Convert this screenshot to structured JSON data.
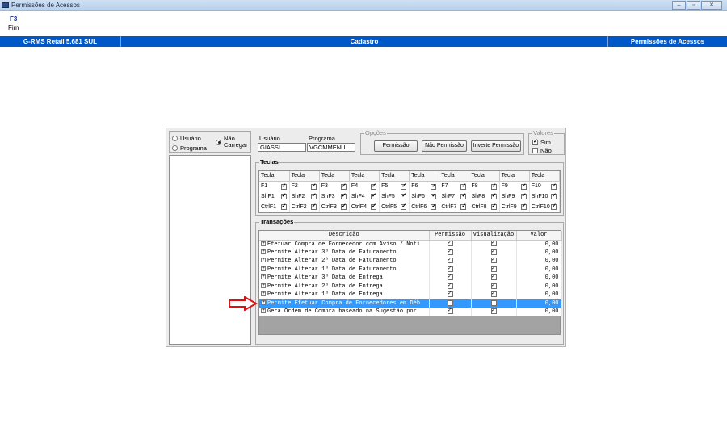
{
  "window": {
    "title": "Permissões de Acessos",
    "btn_min": "–",
    "btn_max": "▫",
    "btn_close": "✕"
  },
  "keyhint": {
    "key": "F3",
    "label": "Fim"
  },
  "header": {
    "app": "G-RMS Retail 5.681 SUL",
    "module": "Cadastro",
    "screen": "Permissões de Acessos"
  },
  "radios": [
    {
      "label": "Usuário",
      "selected": false
    },
    {
      "label": "Programa",
      "selected": false
    },
    {
      "label": "Não Carregar",
      "selected": true
    }
  ],
  "fields": {
    "usuario_label": "Usuário",
    "usuario_value": "GIASSI",
    "programa_label": "Programa",
    "programa_value": "VGCMMENU"
  },
  "opcoes": {
    "label": "Opções",
    "btn_permissao": "Permissão",
    "btn_nao_permissao": "Não Permissão",
    "btn_inverte": "Inverte Permissão"
  },
  "valores": {
    "label": "Valores",
    "sim": "Sim",
    "nao": "Não",
    "sim_checked": true,
    "nao_checked": false
  },
  "teclas": {
    "label": "Teclas",
    "header": "Tecla",
    "rows": [
      [
        "F1",
        "F2",
        "F3",
        "F4",
        "F5",
        "F6",
        "F7",
        "F8",
        "F9",
        "F10"
      ],
      [
        "ShF1",
        "ShF2",
        "ShF3",
        "ShF4",
        "ShF5",
        "ShF6",
        "ShF7",
        "ShF8",
        "ShF9",
        "ShF10"
      ],
      [
        "CtrlF1",
        "CtrlF2",
        "CtrlF3",
        "CtrlF4",
        "CtrlF5",
        "CtrlF6",
        "CtrlF7",
        "CtrlF8",
        "CtrlF9",
        "CtrlF10"
      ]
    ]
  },
  "transacoes": {
    "label": "Transações",
    "columns": [
      "Descrição",
      "Permissão",
      "Visualização",
      "Valor"
    ],
    "rows": [
      {
        "desc": "Efetuar Compra de Fornecedor com Aviso / Noti",
        "perm": true,
        "vis": true,
        "valor": "0,00",
        "selected": false
      },
      {
        "desc": "Permite Alterar 3ª Data de Faturamento",
        "perm": true,
        "vis": true,
        "valor": "0,00",
        "selected": false
      },
      {
        "desc": "Permite Alterar 2ª Data de Faturamento",
        "perm": true,
        "vis": true,
        "valor": "0,00",
        "selected": false
      },
      {
        "desc": "Permite Alterar 1ª Data de Faturamento",
        "perm": true,
        "vis": true,
        "valor": "0,00",
        "selected": false
      },
      {
        "desc": "Permite Alterar 3ª Data de Entrega",
        "perm": true,
        "vis": true,
        "valor": "0,00",
        "selected": false
      },
      {
        "desc": "Permite Alterar 2ª Data de Entrega",
        "perm": true,
        "vis": true,
        "valor": "0,00",
        "selected": false
      },
      {
        "desc": "Permite Alterar 1ª Data de Entrega",
        "perm": true,
        "vis": true,
        "valor": "0,00",
        "selected": false
      },
      {
        "desc": "Permite Efetuar Compra de Fornecedores em Déb",
        "perm": false,
        "vis": false,
        "valor": "0,00",
        "selected": true
      },
      {
        "desc": "Gera Ordem de Compra baseado na Sugestão  por",
        "perm": true,
        "vis": true,
        "valor": "0,00",
        "selected": false
      }
    ]
  },
  "colors": {
    "header_blue": "#0058c8",
    "selection_blue": "#3399ff",
    "arrow_red": "#e01010"
  }
}
